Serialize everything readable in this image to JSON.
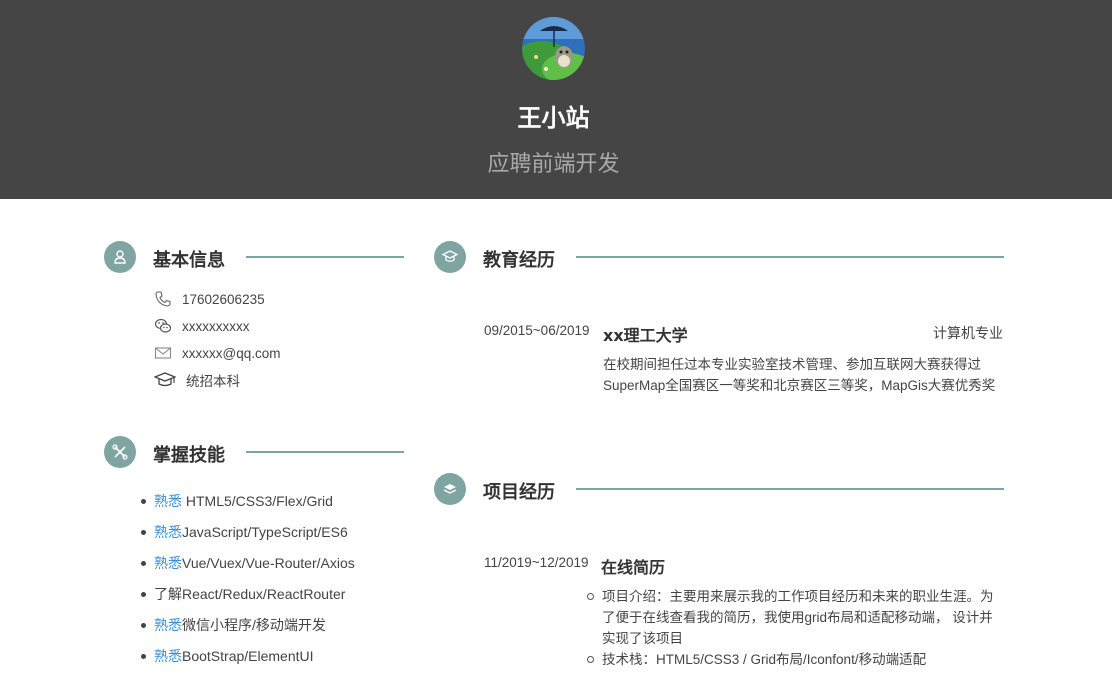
{
  "header": {
    "name": "王小站",
    "subtitle": "应聘前端开发"
  },
  "colors": {
    "header_bg": "#454545",
    "accent": "#7fa5a3",
    "skill_level_link": "#3a8fd6"
  },
  "basic_info": {
    "title": "基本信息",
    "icon": "user-icon",
    "items": [
      {
        "icon": "phone-icon",
        "text": "17602606235"
      },
      {
        "icon": "wechat-icon",
        "text": "xxxxxxxxxx"
      },
      {
        "icon": "mail-icon",
        "text": "xxxxxx@qq.com"
      },
      {
        "icon": "graduation-cap-icon",
        "text": "统招本科"
      }
    ]
  },
  "skills": {
    "title": "掌握技能",
    "icon": "tools-icon",
    "items": [
      {
        "level": "熟悉",
        "text": " HTML5/CSS3/Flex/Grid"
      },
      {
        "level": "熟悉",
        "text": "JavaScript/TypeScript/ES6"
      },
      {
        "level": "熟悉",
        "text": "Vue/Vuex/Vue-Router/Axios"
      },
      {
        "level": "了解",
        "text": "React/Redux/ReactRouter"
      },
      {
        "level": "熟悉",
        "text": "微信小程序/移动端开发"
      },
      {
        "level": "熟悉",
        "text": "BootStrap/ElementUI"
      }
    ]
  },
  "education": {
    "title": "教育经历",
    "icon": "graduation-cap-icon",
    "entries": [
      {
        "date": "09/2015~06/2019",
        "school": "xx理工大学",
        "major": "计算机专业",
        "description": "在校期间担任过本专业实验室技术管理、参加互联网大赛获得过SuperMap全国赛区一等奖和北京赛区三等奖，MapGis大赛优秀奖"
      }
    ]
  },
  "projects": {
    "title": "项目经历",
    "icon": "layers-icon",
    "entries": [
      {
        "date": "11/2019~12/2019",
        "name": "在线简历",
        "points": [
          "项目介绍：主要用来展示我的工作项目经历和未来的职业生涯。为了便于在线查看我的简历，我使用grid布局和适配移动端， 设计并实现了该项目",
          "技术栈：HTML5/CSS3 / Grid布局/Iconfont/移动端适配"
        ]
      }
    ]
  }
}
